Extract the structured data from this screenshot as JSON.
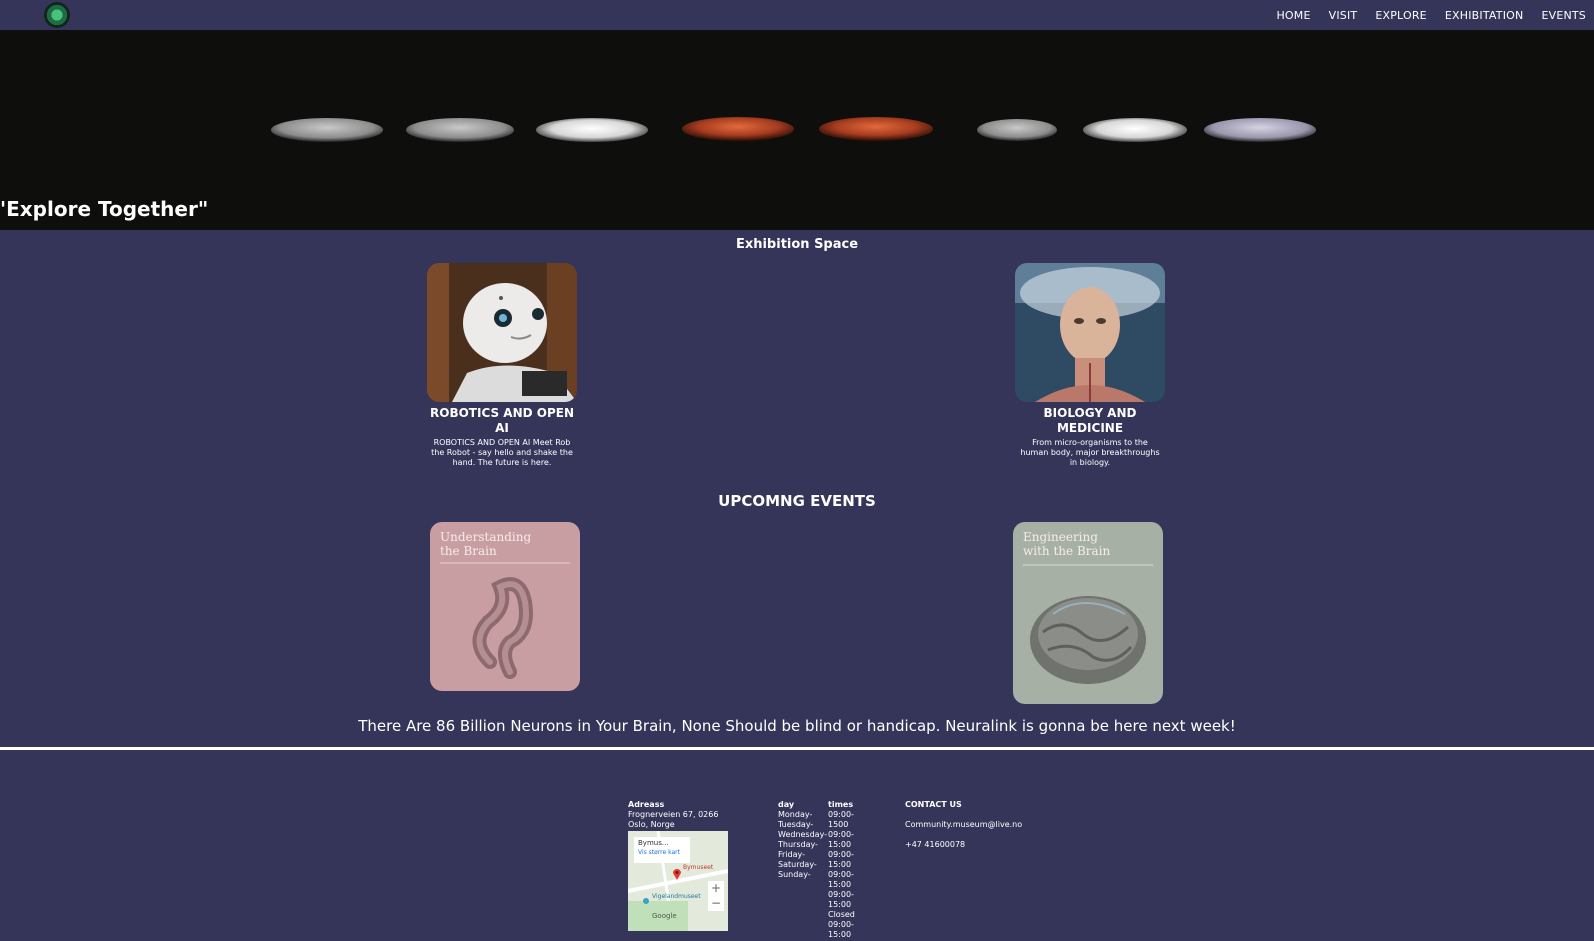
{
  "nav": {
    "logo_icon": "globe-logo-icon",
    "links": [
      "HOME",
      "VISIT",
      "EXPLORE",
      "EXHIBITATION",
      "EVENTS"
    ]
  },
  "hero": {
    "tagline": "'Explore Together\""
  },
  "exhibition": {
    "title": "Exhibition Space",
    "cards": [
      {
        "title": "ROBOTICS AND OPEN AI",
        "desc": "ROBOTICS AND OPEN AI Meet Rob the Robot - say hello and shake the hand. The future is here."
      },
      {
        "title": "BIOLOGY AND MEDICINE",
        "desc": "From micro-organisms to the human body, major breakthroughs in biology."
      }
    ]
  },
  "events": {
    "title": "UPCOMNG EVENTS",
    "items": [
      {
        "caption_line1": "Understanding",
        "caption_line2": "the Brain",
        "color": "#c89ea2"
      },
      {
        "caption_line1": "Engineering",
        "caption_line2": "with the Brain",
        "color": "#a7b0a4"
      }
    ],
    "banner": "There Are 86 Billion Neurons in Your Brain, None Should be blind or handicap. Neuralink is gonna be here next week!"
  },
  "footer": {
    "address": {
      "heading": "Adreass",
      "line1": "Frognerveien 67, 0266",
      "line2": "Oslo, Norge",
      "map": {
        "place_label": "Bymus...",
        "larger_map": "Vis større kart",
        "pin_label": "Bymuseet",
        "nearby": "Vigelandmuseet",
        "zoom_in": "+",
        "zoom_out": "−",
        "google": "Google"
      }
    },
    "hours": {
      "day_heading": "day",
      "time_heading": "times",
      "days": [
        "Monday-",
        "Tuesday-",
        "Wednesday-",
        "Thursday-",
        "Friday-",
        "Saturday-",
        "Sunday-"
      ],
      "times": [
        "09:00-",
        "1500",
        "09:00-",
        "15:00",
        "09:00-",
        "15:00",
        "09:00-",
        "15:00",
        "09:00-",
        "15:00",
        "Closed",
        "09:00-",
        "15:00"
      ]
    },
    "contact": {
      "heading": "CONTACT US",
      "email": "Community.museum@live.no",
      "phone": "+47 41600078"
    }
  }
}
